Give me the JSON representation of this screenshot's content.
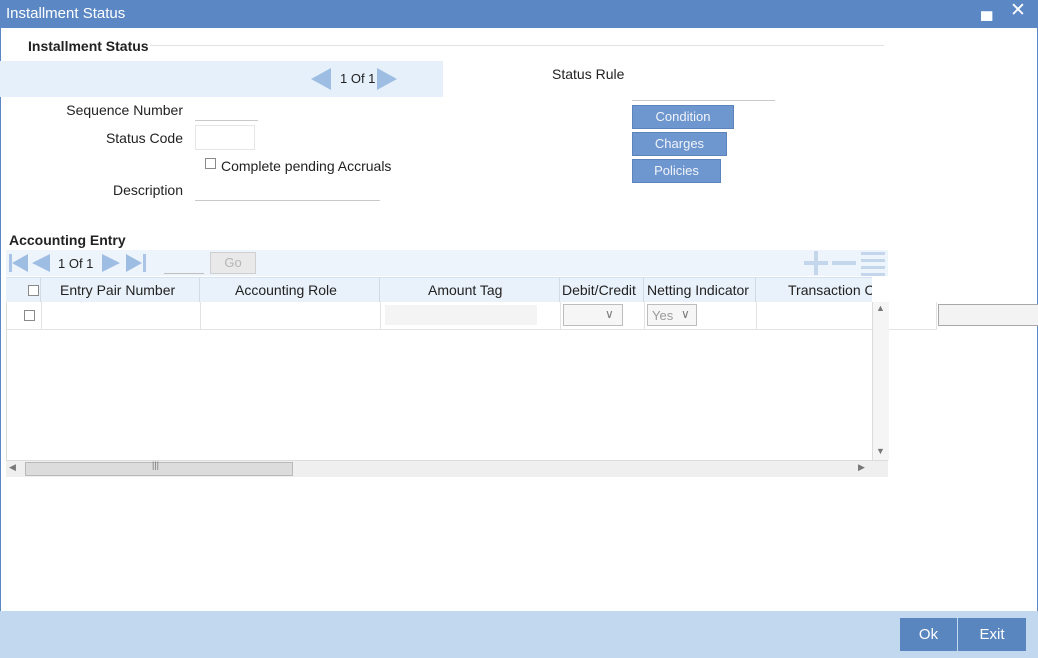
{
  "window": {
    "title": "Installment Status",
    "minimize_icon": "minimize-icon",
    "close_icon": "close-icon"
  },
  "header_section": {
    "title": "Installment Status",
    "pager": {
      "text": "1 Of 1"
    },
    "sequence_number_label": "Sequence Number",
    "sequence_number_value": "",
    "status_code_label": "Status Code",
    "status_code_value": "",
    "complete_pending_accruals_label": "Complete pending Accruals",
    "complete_pending_accruals_checked": false,
    "description_label": "Description",
    "description_value": "",
    "status_rule_label": "Status Rule",
    "status_rule_value": "",
    "buttons": {
      "condition": "Condition",
      "charges": "Charges",
      "policies": "Policies"
    }
  },
  "accounting_entry": {
    "title": "Accounting Entry",
    "pager": {
      "text": "1 Of 1",
      "go_label": "Go",
      "page_value": ""
    },
    "columns": [
      "Entry Pair Number",
      "Accounting Role",
      "Amount Tag",
      "Debit/Credit",
      "Netting Indicator",
      "Transaction Code"
    ],
    "rows": [
      {
        "entry_pair_number": "",
        "accounting_role": "",
        "amount_tag": "",
        "debit_credit": "",
        "netting_indicator": "Yes",
        "transaction_code": ""
      }
    ]
  },
  "footer": {
    "ok_label": "Ok",
    "exit_label": "Exit"
  },
  "colors": {
    "title_bar": "#5b87c4",
    "accent_button": "#6e96cf",
    "footer_bg": "#c2d8ef",
    "footer_button": "#5a86bf"
  }
}
